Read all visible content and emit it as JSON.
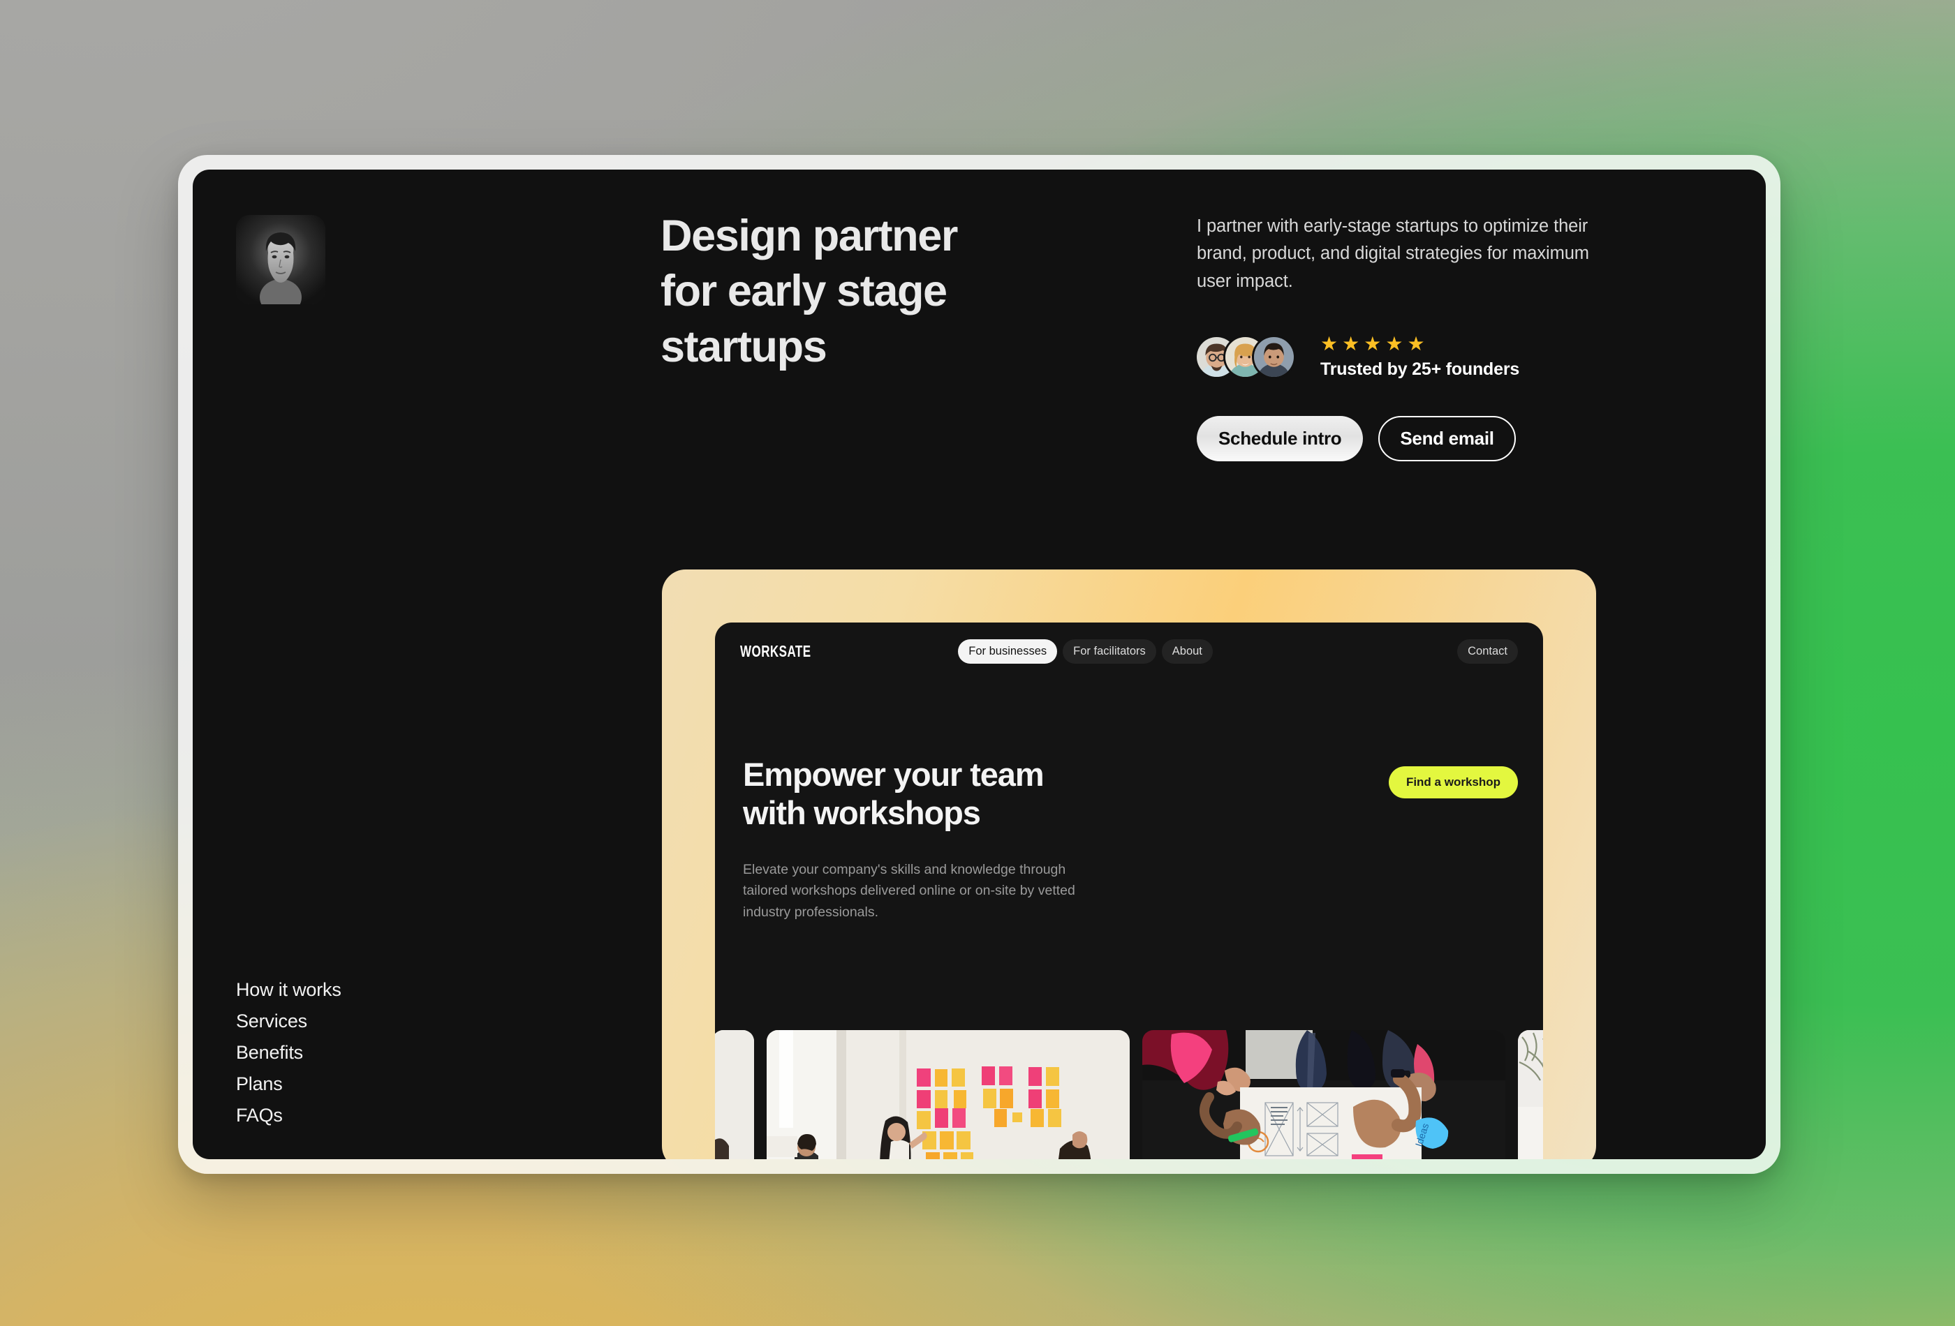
{
  "theme": {
    "card_bg": "#111111",
    "accent_lime": "#e3f73f",
    "star_color": "#fbbf24",
    "frame_gradient_from": "#f1ddb3",
    "frame_gradient_to": "#f2e2c2",
    "bg_green": "#36c14f",
    "bg_gold": "#e0b84f",
    "bg_gray": "#a3a3a0"
  },
  "hero": {
    "avatar_name": "profile-portrait",
    "headline_line1": "Design partner",
    "headline_line2": "for early stage",
    "headline_line3": "startups",
    "lede": "I partner with early-stage startups to optimize their brand, product, and digital strategies for maximum user impact.",
    "rating": {
      "stars_filled": 5,
      "star_glyph": "★",
      "trusted_label": "Trusted by 25+ founders"
    },
    "buttons": {
      "primary": "Schedule intro",
      "secondary": "Send email"
    }
  },
  "sidenav": {
    "items": [
      {
        "label": "How it works"
      },
      {
        "label": "Services"
      },
      {
        "label": "Benefits"
      },
      {
        "label": "Plans"
      },
      {
        "label": "FAQs"
      }
    ]
  },
  "mockup": {
    "logo": "WORKSATE",
    "nav": {
      "items": [
        {
          "label": "For businesses",
          "active": true
        },
        {
          "label": "For facilitators",
          "active": false
        },
        {
          "label": "About",
          "active": false
        }
      ],
      "contact": "Contact"
    },
    "hero": {
      "title_line1": "Empower your team",
      "title_line2": "with workshops",
      "body_line1": "Elevate your company's skills and knowledge through",
      "body_line2": "tailored workshops delivered online or on-site by vetted",
      "body_line3": "industry professionals.",
      "cta": "Find a workshop"
    },
    "carousel": {
      "cards": [
        {
          "name": "workshop-photo-partial-left"
        },
        {
          "name": "workshop-photo-sticky-notes"
        },
        {
          "name": "workshop-photo-blueprint-table"
        },
        {
          "name": "workshop-photo-partial-right"
        }
      ]
    }
  }
}
